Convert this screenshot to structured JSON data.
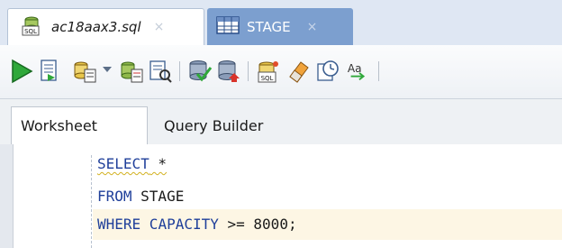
{
  "tabs": [
    {
      "label": "ac18aax3.sql",
      "icon": "sql-file-icon",
      "active": true,
      "close": "×"
    },
    {
      "label": "STAGE",
      "icon": "table-grid-icon",
      "active": false,
      "close": "×"
    }
  ],
  "toolbar": {
    "buttons": [
      {
        "name": "run-statement-button",
        "icon": "run-icon"
      },
      {
        "name": "run-script-button",
        "icon": "script-icon"
      },
      {
        "name": "autotrace-button",
        "icon": "autotrace-icon"
      },
      {
        "name": "explain-plan-button",
        "icon": "explain-plan-icon"
      },
      {
        "name": "sql-tuning-button",
        "icon": "tuning-icon"
      },
      {
        "name": "commit-button",
        "icon": "commit-icon"
      },
      {
        "name": "rollback-button",
        "icon": "rollback-icon"
      },
      {
        "name": "unshared-sql-button",
        "icon": "unshared-sql-icon"
      },
      {
        "name": "clear-button",
        "icon": "eraser-icon"
      },
      {
        "name": "history-button",
        "icon": "history-icon"
      },
      {
        "name": "format-button",
        "icon": "format-case-icon"
      }
    ]
  },
  "subtabs": [
    {
      "label": "Worksheet",
      "active": true
    },
    {
      "label": "Query Builder",
      "active": false
    }
  ],
  "editor": {
    "lines": [
      {
        "kw1": "SELECT",
        "rest": " *"
      },
      {
        "kw1": "FROM",
        "rest": " STAGE"
      },
      {
        "kw1": "WHERE",
        "kw2": " CAPACITY",
        "op": " >=",
        "num": " 8000",
        "end": ";"
      }
    ]
  },
  "colors": {
    "keyword": "#1f3f9a",
    "active_line": "#fdf6e4",
    "tab_inactive": "#7c9fcf",
    "run_green": "#2fa83a"
  }
}
